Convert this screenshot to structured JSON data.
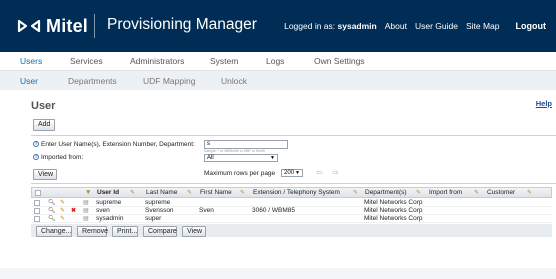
{
  "header": {
    "logo_text": "Mitel",
    "app_title": "Provisioning Manager",
    "logged_in_prefix": "Logged in as:",
    "logged_in_user": "sysadmin",
    "links": [
      "About",
      "User Guide",
      "Site Map"
    ],
    "logout": "Logout"
  },
  "nav_primary": [
    "Users",
    "Services",
    "Administrators",
    "System",
    "Logs",
    "Own Settings"
  ],
  "nav_secondary": [
    "User",
    "Departments",
    "UDF Mapping",
    "Unlock"
  ],
  "page": {
    "title": "User",
    "help": "Help",
    "add_button": "Add"
  },
  "filter": {
    "search_label": "Enter User Name(s), Extension Number, Department:",
    "search_value": "s",
    "search_hint": "Sample: * or WBSmith or WB* or Smith",
    "imported_label": "Imported from:",
    "imported_value": "All",
    "view_button": "View",
    "max_rows_label": "Maximum rows per page",
    "max_rows_value": "200"
  },
  "table": {
    "columns": [
      "User Id",
      "Last Name",
      "First Name",
      "Extension / Telephony System",
      "Department(s)",
      "Import from",
      "Customer"
    ],
    "rows": [
      {
        "user_id": "supreme",
        "last_name": "supreme",
        "first_name": "",
        "extension": "",
        "department": "Mitel Networks Corp",
        "import_from": "",
        "customer": "",
        "deletable": false
      },
      {
        "user_id": "sven",
        "last_name": "Svensson",
        "first_name": "Sven",
        "extension": "3060 / WBM85",
        "department": "Mitel Networks Corp",
        "import_from": "",
        "customer": "",
        "deletable": true
      },
      {
        "user_id": "sysadmin",
        "last_name": "super",
        "first_name": "",
        "extension": "",
        "department": "Mitel Networks Corp",
        "import_from": "",
        "customer": "",
        "deletable": false
      }
    ]
  },
  "actions": [
    "Change...",
    "Remove",
    "Print...",
    "Compare",
    "View"
  ],
  "colors": {
    "header_bg": "#002d56",
    "accent": "#0072bb",
    "delete": "#d92020"
  }
}
